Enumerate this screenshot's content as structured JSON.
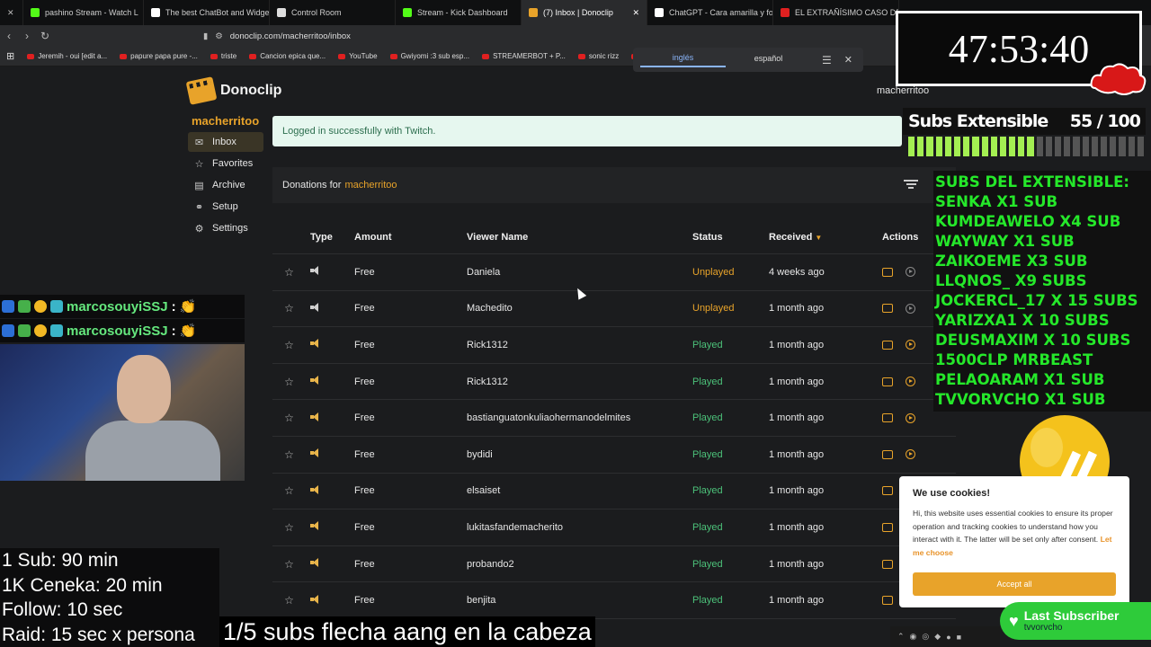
{
  "browser": {
    "tabs": [
      {
        "label": "pashino Stream - Watch L",
        "color": "#53fc18",
        "active": false
      },
      {
        "label": "The best ChatBot and Widget",
        "color": "#ffffff",
        "active": false
      },
      {
        "label": "Control Room",
        "color": "#dddddd",
        "active": false
      },
      {
        "label": "Stream - Kick Dashboard",
        "color": "#53fc18",
        "active": false
      },
      {
        "label": "(7) Inbox | Donoclip",
        "color": "#e8a32a",
        "active": true
      },
      {
        "label": "ChatGPT - Cara amarilla y foc",
        "color": "#ffffff",
        "active": false
      },
      {
        "label": "EL EXTRAÑÍSIMO CASO DE N",
        "color": "#e02020",
        "active": false
      }
    ],
    "url": "donoclip.com/macherritoo/inbox",
    "bookmarks": [
      {
        "label": "Jeremih - oui [edit a..."
      },
      {
        "label": "papure papa pure -..."
      },
      {
        "label": "triste"
      },
      {
        "label": "Cancion epica que..."
      },
      {
        "label": "YouTube"
      },
      {
        "label": "Gwiyomi :3 sub esp..."
      },
      {
        "label": "STREAMERBOT + P..."
      },
      {
        "label": "sonic rizz"
      },
      {
        "label": "(10)"
      }
    ],
    "translate": {
      "lang_a": "inglés",
      "lang_b": "español"
    }
  },
  "app": {
    "brand": "Donoclip",
    "channel": "macherritoo",
    "user": "macherritoo",
    "sidebar": [
      {
        "label": "Inbox",
        "icon": "inbox-icon",
        "glyph": "✉",
        "active": true
      },
      {
        "label": "Favorites",
        "icon": "star-icon",
        "glyph": "☆",
        "active": false
      },
      {
        "label": "Archive",
        "icon": "archive-icon",
        "glyph": "▤",
        "active": false
      },
      {
        "label": "Setup",
        "icon": "link-icon",
        "glyph": "⚭",
        "active": false
      },
      {
        "label": "Settings",
        "icon": "gear-icon",
        "glyph": "⚙",
        "active": false
      }
    ],
    "alert": "Logged in successfully with Twitch.",
    "donations_prefix": "Donations for",
    "table": {
      "headers": {
        "type": "Type",
        "amount": "Amount",
        "viewer": "Viewer Name",
        "status": "Status",
        "received": "Received",
        "actions": "Actions"
      },
      "rows": [
        {
          "amount": "Free",
          "viewer": "Daniela",
          "status": "Unplayed",
          "received": "4 weeks ago"
        },
        {
          "amount": "Free",
          "viewer": "Machedito",
          "status": "Unplayed",
          "received": "1 month ago"
        },
        {
          "amount": "Free",
          "viewer": "Rick1312",
          "status": "Played",
          "received": "1 month ago"
        },
        {
          "amount": "Free",
          "viewer": "Rick1312",
          "status": "Played",
          "received": "1 month ago"
        },
        {
          "amount": "Free",
          "viewer": "bastianguatonkuliaohermanodelmites",
          "status": "Played",
          "received": "1 month ago"
        },
        {
          "amount": "Free",
          "viewer": "bydidi",
          "status": "Played",
          "received": "1 month ago"
        },
        {
          "amount": "Free",
          "viewer": "elsaiset",
          "status": "Played",
          "received": "1 month ago"
        },
        {
          "amount": "Free",
          "viewer": "lukitasfandemacherito",
          "status": "Played",
          "received": "1 month ago"
        },
        {
          "amount": "Free",
          "viewer": "probando2",
          "status": "Played",
          "received": "1 month ago"
        },
        {
          "amount": "Free",
          "viewer": "benjita",
          "status": "Played",
          "received": "1 month ago"
        }
      ]
    },
    "cookie": {
      "title": "We use cookies!",
      "text": "Hi, this website uses essential cookies to ensure its proper operation and tracking cookies to understand how you interact with it. The latter will be set only after consent.",
      "link": "Let me choose",
      "accept": "Accept all"
    }
  },
  "overlay": {
    "timer": "47:53:40",
    "subs_title": "Subs Extensible",
    "subs_count": "55 / 100",
    "subs_progress": 0.55,
    "subs_list": [
      "SUBS DEL EXTENSIBLE:",
      "SENKA X1 SUB",
      "KUMDEAWELO X4 SUB",
      "WAYWAY X1 SUB",
      "ZAIKOEME X3 SUB",
      "LLQNOS_ X9 SUBS",
      "JOCKERCL_17 X 15 SUBS",
      "YARIZXA1 X 10 SUBS",
      "DEUSMAXIM X 10 SUBS",
      "1500CLP MRBEAST",
      "PELAOARAM X1 SUB",
      "TVVORVCHO X1 SUB"
    ],
    "chat": [
      {
        "user": "marcosouyiSSJ",
        "sep": ":"
      },
      {
        "user": "marcosouyiSSJ",
        "sep": ":"
      }
    ],
    "rules": [
      "1 Sub: 90 min",
      "1K Ceneka: 20 min",
      "Follow: 10 sec",
      "Raid: 15 sec x persona"
    ],
    "caption": "1/5 subs flecha aang en la cabeza",
    "last_sub_title": "Last Subscriber",
    "last_sub_name": "tvvorvcho",
    "x3_label": "X3"
  }
}
